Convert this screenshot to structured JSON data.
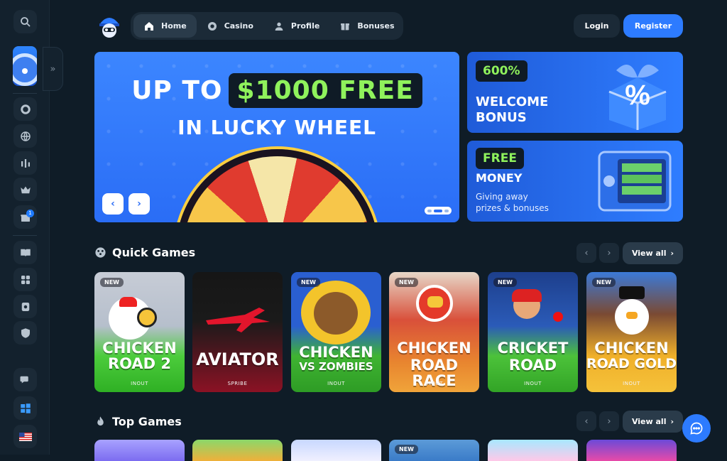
{
  "nav": {
    "items": [
      {
        "label": "Home",
        "active": true,
        "icon": "home-icon"
      },
      {
        "label": "Casino",
        "active": false,
        "icon": "chip-icon"
      },
      {
        "label": "Profile",
        "active": false,
        "icon": "user-icon"
      },
      {
        "label": "Bonuses",
        "active": false,
        "icon": "gift-icon"
      }
    ]
  },
  "auth": {
    "login": "Login",
    "register": "Register"
  },
  "hero": {
    "line1_pre": "UP TO",
    "line1_highlight": "$1000 FREE",
    "line2": "IN LUCKY WHEEL",
    "prev": "‹",
    "next": "›"
  },
  "promos": [
    {
      "tag": "600%",
      "title1": "WELCOME",
      "title2": "BONUS"
    },
    {
      "tag": "FREE",
      "title": "MONEY",
      "sub1": "Giving away",
      "sub2": "prizes & bonuses"
    }
  ],
  "sidebar": {
    "expand": "»",
    "badge": "1"
  },
  "quick_games": {
    "title": "Quick Games",
    "view_all": "View all",
    "cards": [
      {
        "title1": "CHICKEN",
        "title2": "ROAD 2",
        "provider": "INOUT",
        "new": "NEW"
      },
      {
        "title1": "AVIATOR",
        "title2": "",
        "provider": "SPRIBE",
        "new": ""
      },
      {
        "title1": "CHICKEN",
        "title2": "VS ZOMBIES",
        "provider": "INOUT",
        "new": "NEW"
      },
      {
        "title1": "CHICKEN",
        "title2": "ROAD RACE",
        "provider": "INOUT",
        "new": "NEW"
      },
      {
        "title1": "CRICKET",
        "title2": "ROAD",
        "provider": "INOUT",
        "new": "NEW"
      },
      {
        "title1": "CHICKEN",
        "title2": "ROAD GOLD",
        "provider": "INOUT",
        "new": "NEW"
      }
    ]
  },
  "top_games": {
    "title": "Top Games",
    "view_all": "View all",
    "new": "NEW"
  },
  "colors": {
    "accent": "#2d7bff",
    "highlight": "#8ff25c",
    "bg": "#0f1c27"
  }
}
